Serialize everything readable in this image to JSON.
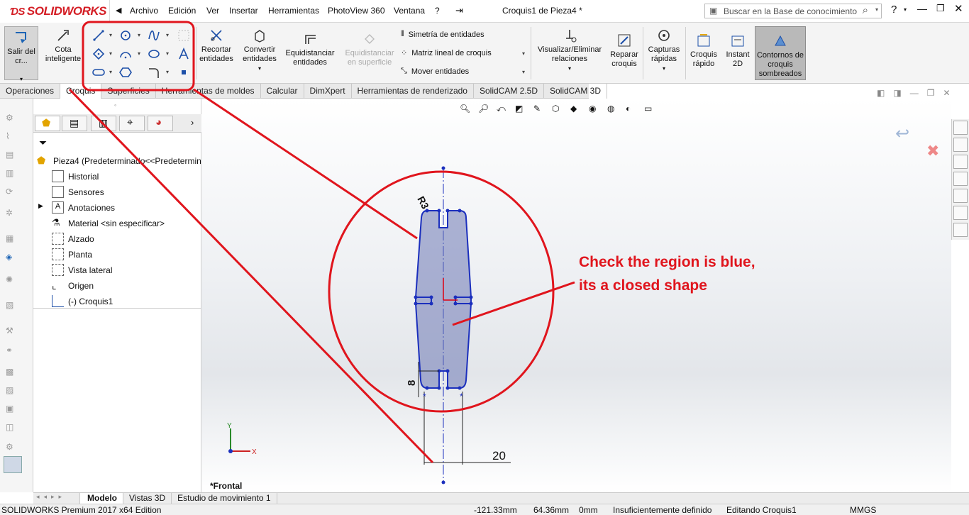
{
  "app": {
    "brand": "SOLIDWORKS",
    "menu": [
      "Archivo",
      "Edición",
      "Ver",
      "Insertar",
      "Herramientas",
      "PhotoView 360",
      "Ventana",
      "?"
    ],
    "document_title": "Croquis1 de Pieza4 *",
    "search_placeholder": "Buscar en la Base de conocimiento",
    "help_label": "?"
  },
  "toolbar": {
    "exit_sketch": "Salir del cr...",
    "smart_dimension": "Cota inteligente",
    "trim": "Recortar entidades",
    "convert": "Convertir entidades",
    "offset": "Equidistanciar entidades",
    "offset_surface": "Equidistanciar en superficie",
    "mirror": "Simetría de entidades",
    "linear_pattern": "Matriz lineal de croquis",
    "move": "Mover entidades",
    "relations": "Visualizar/Eliminar relaciones",
    "repair": "Reparar croquis",
    "quick_snaps": "Capturas rápidas",
    "rapid_sketch": "Croquis rápido",
    "instant2d": "Instant 2D",
    "shaded_contours": "Contornos de croquis sombreados"
  },
  "tabs": [
    "Operaciones",
    "Croquis",
    "Superficies",
    "Herramientas de moldes",
    "Calcular",
    "DimXpert",
    "Herramientas de renderizado",
    "SolidCAM 2.5D",
    "SolidCAM 3D"
  ],
  "feature_tree": {
    "root": "Pieza4  (Predeterminado<<Predetermin",
    "items": [
      "Historial",
      "Sensores",
      "Anotaciones",
      "Material <sin especificar>",
      "Alzado",
      "Planta",
      "Vista lateral",
      "Origen",
      "(-) Croquis1"
    ]
  },
  "sketch": {
    "dims": {
      "radius": "R3",
      "height": "8",
      "width": "20"
    },
    "view_label": "*Frontal",
    "triad": {
      "y": "Y",
      "x": "X"
    }
  },
  "annotation": {
    "line1": "Check the region is blue,",
    "line2": "its a closed shape",
    "color": "#e0151d"
  },
  "bottom_tabs": [
    "Modelo",
    "Vistas 3D",
    "Estudio de movimiento 1"
  ],
  "status": {
    "edition": "SOLIDWORKS Premium 2017 x64 Edition",
    "x": "-121.33mm",
    "y": "64.36mm",
    "z": "0mm",
    "definition": "Insuficientemente definido",
    "editing": "Editando Croquis1",
    "units": "MMGS"
  }
}
